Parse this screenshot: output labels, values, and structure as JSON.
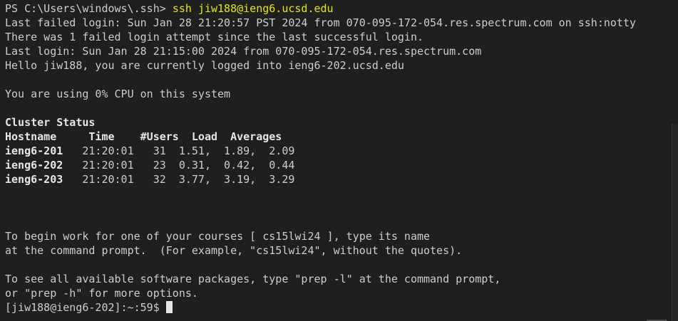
{
  "prompt_line": {
    "prompt": "PS C:\\Users\\windows\\.ssh> ",
    "command": "ssh jiw188@ieng6.ucsd.edu"
  },
  "login_info": [
    "Last failed login: Sun Jan 28 21:20:57 PST 2024 from 070-095-172-054.res.spectrum.com on ssh:notty",
    "There was 1 failed login attempt since the last successful login.",
    "Last login: Sun Jan 28 21:15:00 2024 from 070-095-172-054.res.spectrum.com",
    "Hello jiw188, you are currently logged into ieng6-202.ucsd.edu"
  ],
  "cpu_line": "You are using 0% CPU on this system",
  "cluster": {
    "title": "Cluster Status",
    "header": "Hostname     Time    #Users  Load  Averages",
    "rows": [
      {
        "host": "ieng6-201",
        "rest": "   21:20:01   31  1.51,  1.89,  2.09"
      },
      {
        "host": "ieng6-202",
        "rest": "   21:20:01   23  0.31,  0.42,  0.44"
      },
      {
        "host": "ieng6-203",
        "rest": "   21:20:01   32  3.77,  3.19,  3.29"
      }
    ]
  },
  "course_info": [
    "To begin work for one of your courses [ cs15lwi24 ], type its name",
    "at the command prompt.  (For example, \"cs15lwi24\", without the quotes)."
  ],
  "software_info": [
    "To see all available software packages, type \"prep -l\" at the command prompt,",
    "or \"prep -h\" for more options."
  ],
  "shell_prompt": "[jiw188@ieng6-202]:~:59$ "
}
